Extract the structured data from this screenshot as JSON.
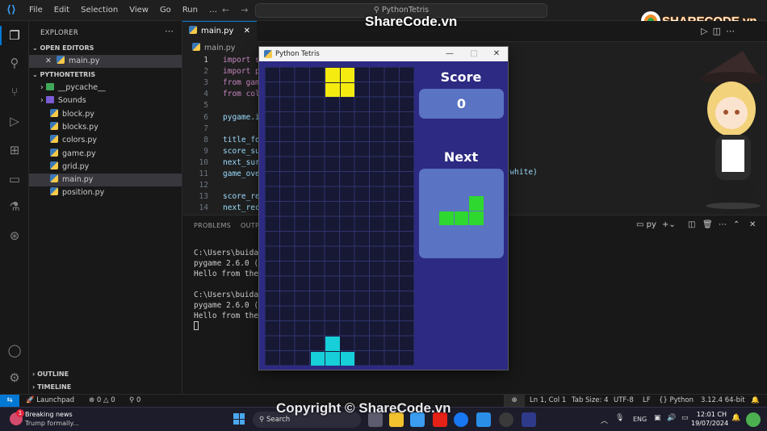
{
  "titlebar": {
    "menus": [
      "File",
      "Edit",
      "Selection",
      "View",
      "Go",
      "Run",
      "…"
    ],
    "command_center": "PythonTetris"
  },
  "sidebar": {
    "header": "EXPLORER",
    "open_editors_label": "OPEN EDITORS",
    "open_editor_file": "main.py",
    "project_label": "PYTHONTETRIS",
    "items": [
      {
        "label": "__pycache__",
        "kind": "folder",
        "color": "#40a858"
      },
      {
        "label": "Sounds",
        "kind": "folder",
        "color": "#7a5cd6"
      },
      {
        "label": "block.py",
        "kind": "python"
      },
      {
        "label": "blocks.py",
        "kind": "python"
      },
      {
        "label": "colors.py",
        "kind": "python"
      },
      {
        "label": "game.py",
        "kind": "python"
      },
      {
        "label": "grid.py",
        "kind": "python"
      },
      {
        "label": "main.py",
        "kind": "python",
        "selected": true
      },
      {
        "label": "position.py",
        "kind": "python"
      }
    ],
    "outline_label": "OUTLINE",
    "timeline_label": "TIMELINE"
  },
  "editor": {
    "tab_label": "main.py",
    "breadcrumb": "main.py",
    "lines": [
      {
        "n": "1",
        "code": "import s",
        "current": true
      },
      {
        "n": "2",
        "code": "import p"
      },
      {
        "n": "3",
        "code": "from gam"
      },
      {
        "n": "4",
        "code": "from col"
      },
      {
        "n": "5",
        "code": ""
      },
      {
        "n": "6",
        "code": "pygame.i"
      },
      {
        "n": "7",
        "code": ""
      },
      {
        "n": "8",
        "code": "title_fo"
      },
      {
        "n": "9",
        "code": "score_su"
      },
      {
        "n": "10",
        "code": "next_sur"
      },
      {
        "n": "11",
        "code": "game_ove"
      },
      {
        "n": "12",
        "code": ""
      },
      {
        "n": "13",
        "code": "score_re"
      },
      {
        "n": "14",
        "code": "next_rec"
      }
    ],
    "line11_tail": "s.white)"
  },
  "panel": {
    "tabs": [
      "PROBLEMS",
      "OUTPU"
    ],
    "terminal_kind": "py",
    "terminal_lines": [
      "C:\\Users\\buida\\",
      "pygame 2.6.0 (S",
      "Hello from the ",
      "",
      "C:\\Users\\buida\\",
      "pygame 2.6.0 (S",
      "Hello from the "
    ]
  },
  "statusbar": {
    "launchpad": "Launchpad",
    "errors": "0",
    "warnings": "0",
    "ports": "0",
    "position": "Ln 1, Col 1",
    "tab_size": "Tab Size: 4",
    "encoding": "UTF-8",
    "eol": "LF",
    "language": "Python",
    "interpreter": "3.12.4 64-bit"
  },
  "taskbar": {
    "news_title": "Breaking news",
    "news_sub": "Trump formally...",
    "news_badge": "1",
    "search_placeholder": "Search",
    "lang": "ENG",
    "time": "12:01 CH",
    "date": "19/07/2024"
  },
  "tetris": {
    "window_title": "Python Tetris",
    "score_label": "Score",
    "score_value": "0",
    "next_label": "Next",
    "grid_cols": 10,
    "grid_rows": 20,
    "current_piece": {
      "name": "O",
      "color": "#f5eb10",
      "cells": [
        [
          0,
          4
        ],
        [
          0,
          5
        ],
        [
          1,
          4
        ],
        [
          1,
          5
        ]
      ]
    },
    "placed_piece": {
      "name": "T",
      "color": "#17cfd8",
      "cells": [
        [
          18,
          4
        ],
        [
          19,
          3
        ],
        [
          19,
          4
        ],
        [
          19,
          5
        ]
      ]
    },
    "next_piece": {
      "name": "L",
      "color": "#2fd82f",
      "cells": [
        [
          0,
          2
        ],
        [
          1,
          0
        ],
        [
          1,
          1
        ],
        [
          1,
          2
        ]
      ]
    }
  },
  "watermark": {
    "top": "ShareCode.vn",
    "bottom": "Copyright © ShareCode.vn",
    "logo": "SHARECODE.vn"
  },
  "colors": {
    "accent": "#0078d4",
    "tetris_bg": "#2c2a82",
    "grid_bg": "#171833",
    "panel_box": "#5a73c2"
  }
}
